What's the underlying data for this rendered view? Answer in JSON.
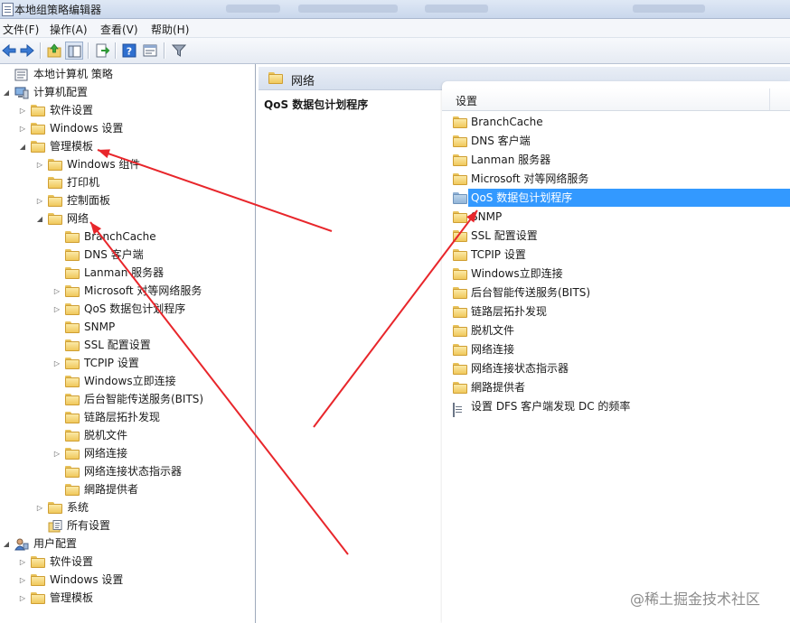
{
  "window": {
    "title": "本地组策略编辑器"
  },
  "menu": [
    "文件(F)",
    "操作(A)",
    "查看(V)",
    "帮助(H)"
  ],
  "toolbar": [
    "back-icon",
    "forward-icon",
    "up-folder-icon",
    "show-hide-tree-icon",
    "export-icon",
    "help-icon",
    "properties-icon",
    "filter-icon"
  ],
  "tree": [
    {
      "label": "本地计算机 策略",
      "level": 0,
      "expander": "none",
      "icon": "computer-policy-icon"
    },
    {
      "label": "计算机配置",
      "level": 0,
      "expander": "expanded",
      "icon": "computer-config-icon"
    },
    {
      "label": "软件设置",
      "level": 1,
      "expander": "collapsed",
      "icon": "folder-icon"
    },
    {
      "label": "Windows 设置",
      "level": 1,
      "expander": "collapsed",
      "icon": "folder-icon"
    },
    {
      "label": "管理模板",
      "level": 1,
      "expander": "expanded",
      "icon": "folder-icon"
    },
    {
      "label": "Windows 组件",
      "level": 2,
      "expander": "collapsed",
      "icon": "folder-icon"
    },
    {
      "label": "打印机",
      "level": 2,
      "expander": "none",
      "icon": "folder-icon"
    },
    {
      "label": "控制面板",
      "level": 2,
      "expander": "collapsed",
      "icon": "folder-icon"
    },
    {
      "label": "网络",
      "level": 2,
      "expander": "expanded",
      "icon": "folder-icon"
    },
    {
      "label": "BranchCache",
      "level": 3,
      "expander": "none",
      "icon": "folder-icon"
    },
    {
      "label": "DNS 客户端",
      "level": 3,
      "expander": "none",
      "icon": "folder-icon"
    },
    {
      "label": "Lanman 服务器",
      "level": 3,
      "expander": "none",
      "icon": "folder-icon"
    },
    {
      "label": "Microsoft 对等网络服务",
      "level": 3,
      "expander": "collapsed",
      "icon": "folder-icon"
    },
    {
      "label": "QoS 数据包计划程序",
      "level": 3,
      "expander": "collapsed",
      "icon": "folder-icon"
    },
    {
      "label": "SNMP",
      "level": 3,
      "expander": "none",
      "icon": "folder-icon"
    },
    {
      "label": "SSL 配置设置",
      "level": 3,
      "expander": "none",
      "icon": "folder-icon"
    },
    {
      "label": "TCPIP 设置",
      "level": 3,
      "expander": "collapsed",
      "icon": "folder-icon"
    },
    {
      "label": "Windows立即连接",
      "level": 3,
      "expander": "none",
      "icon": "folder-icon"
    },
    {
      "label": "后台智能传送服务(BITS)",
      "level": 3,
      "expander": "none",
      "icon": "folder-icon"
    },
    {
      "label": "链路层拓扑发现",
      "level": 3,
      "expander": "none",
      "icon": "folder-icon"
    },
    {
      "label": "脱机文件",
      "level": 3,
      "expander": "none",
      "icon": "folder-icon"
    },
    {
      "label": "网络连接",
      "level": 3,
      "expander": "collapsed",
      "icon": "folder-icon"
    },
    {
      "label": "网络连接状态指示器",
      "level": 3,
      "expander": "none",
      "icon": "folder-icon"
    },
    {
      "label": "網路提供者",
      "level": 3,
      "expander": "none",
      "icon": "folder-icon"
    },
    {
      "label": "系统",
      "level": 2,
      "expander": "collapsed",
      "icon": "folder-icon"
    },
    {
      "label": "所有设置",
      "level": 2,
      "expander": "none",
      "icon": "all-settings-icon"
    },
    {
      "label": "用户配置",
      "level": 0,
      "expander": "expanded",
      "icon": "user-config-icon"
    },
    {
      "label": "软件设置",
      "level": 1,
      "expander": "collapsed",
      "icon": "folder-icon"
    },
    {
      "label": "Windows 设置",
      "level": 1,
      "expander": "collapsed",
      "icon": "folder-icon"
    },
    {
      "label": "管理模板",
      "level": 1,
      "expander": "collapsed",
      "icon": "folder-icon"
    }
  ],
  "right": {
    "header_label": "网络",
    "description_title": "QoS 数据包计划程序",
    "column_header": "设置",
    "items": [
      {
        "label": "BranchCache",
        "icon": "folder-icon",
        "selected": false
      },
      {
        "label": "DNS 客户端",
        "icon": "folder-icon",
        "selected": false
      },
      {
        "label": "Lanman 服务器",
        "icon": "folder-icon",
        "selected": false
      },
      {
        "label": "Microsoft 对等网络服务",
        "icon": "folder-icon",
        "selected": false
      },
      {
        "label": "QoS 数据包计划程序",
        "icon": "folder-icon",
        "selected": true
      },
      {
        "label": "SNMP",
        "icon": "folder-icon",
        "selected": false
      },
      {
        "label": "SSL 配置设置",
        "icon": "folder-icon",
        "selected": false
      },
      {
        "label": "TCPIP 设置",
        "icon": "folder-icon",
        "selected": false
      },
      {
        "label": "Windows立即连接",
        "icon": "folder-icon",
        "selected": false
      },
      {
        "label": "后台智能传送服务(BITS)",
        "icon": "folder-icon",
        "selected": false
      },
      {
        "label": "链路层拓扑发现",
        "icon": "folder-icon",
        "selected": false
      },
      {
        "label": "脱机文件",
        "icon": "folder-icon",
        "selected": false
      },
      {
        "label": "网络连接",
        "icon": "folder-icon",
        "selected": false
      },
      {
        "label": "网络连接状态指示器",
        "icon": "folder-icon",
        "selected": false
      },
      {
        "label": "網路提供者",
        "icon": "folder-icon",
        "selected": false
      },
      {
        "label": "设置 DFS 客户端发现 DC 的频率",
        "icon": "setting-icon",
        "selected": false
      }
    ]
  },
  "annotation_color": "#e8262b",
  "watermark": "@稀土掘金技术社区"
}
